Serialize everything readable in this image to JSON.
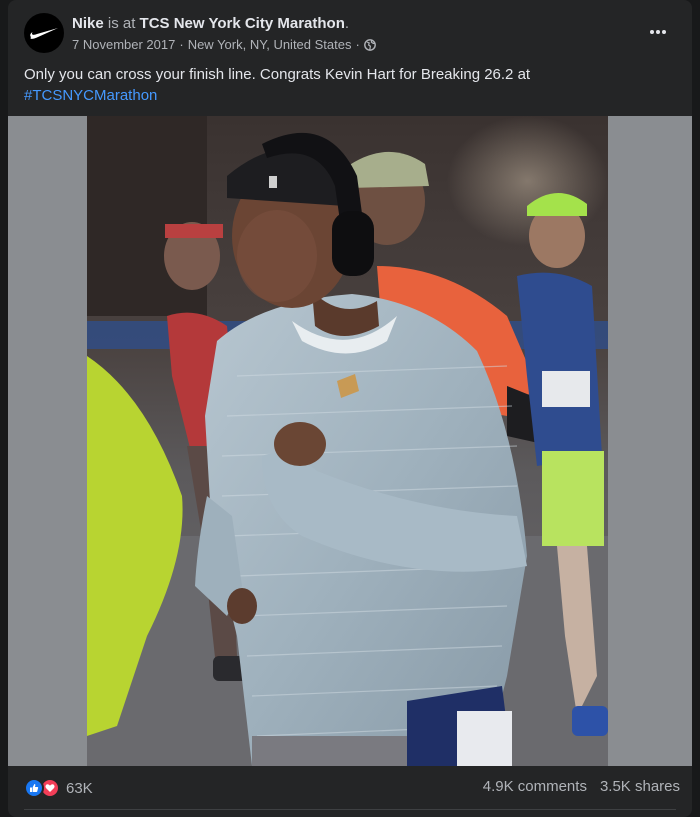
{
  "post": {
    "page_name": "Nike",
    "is_at_text": " is at ",
    "location_name": "TCS New York City Marathon",
    "trailing_dot": ".",
    "date": "7 November 2017",
    "separator": "·",
    "place": "New York, NY, United States",
    "privacy_icon": "globe-icon",
    "caption": "Only you can cross your finish line. Congrats Kevin Hart for Breaking 26.2 at",
    "hashtag": "#TCSNYCMarathon"
  },
  "engagement": {
    "reaction_icons": [
      "like-icon",
      "love-icon"
    ],
    "reaction_count": "63K",
    "comments": "4.9K comments",
    "shares": "3.5K shares"
  },
  "colors": {
    "background": "#242526",
    "text_primary": "#e4e6eb",
    "text_secondary": "#b0b3b8",
    "link": "#4599ff",
    "like": "#1877f2",
    "love": "#f33e58"
  }
}
